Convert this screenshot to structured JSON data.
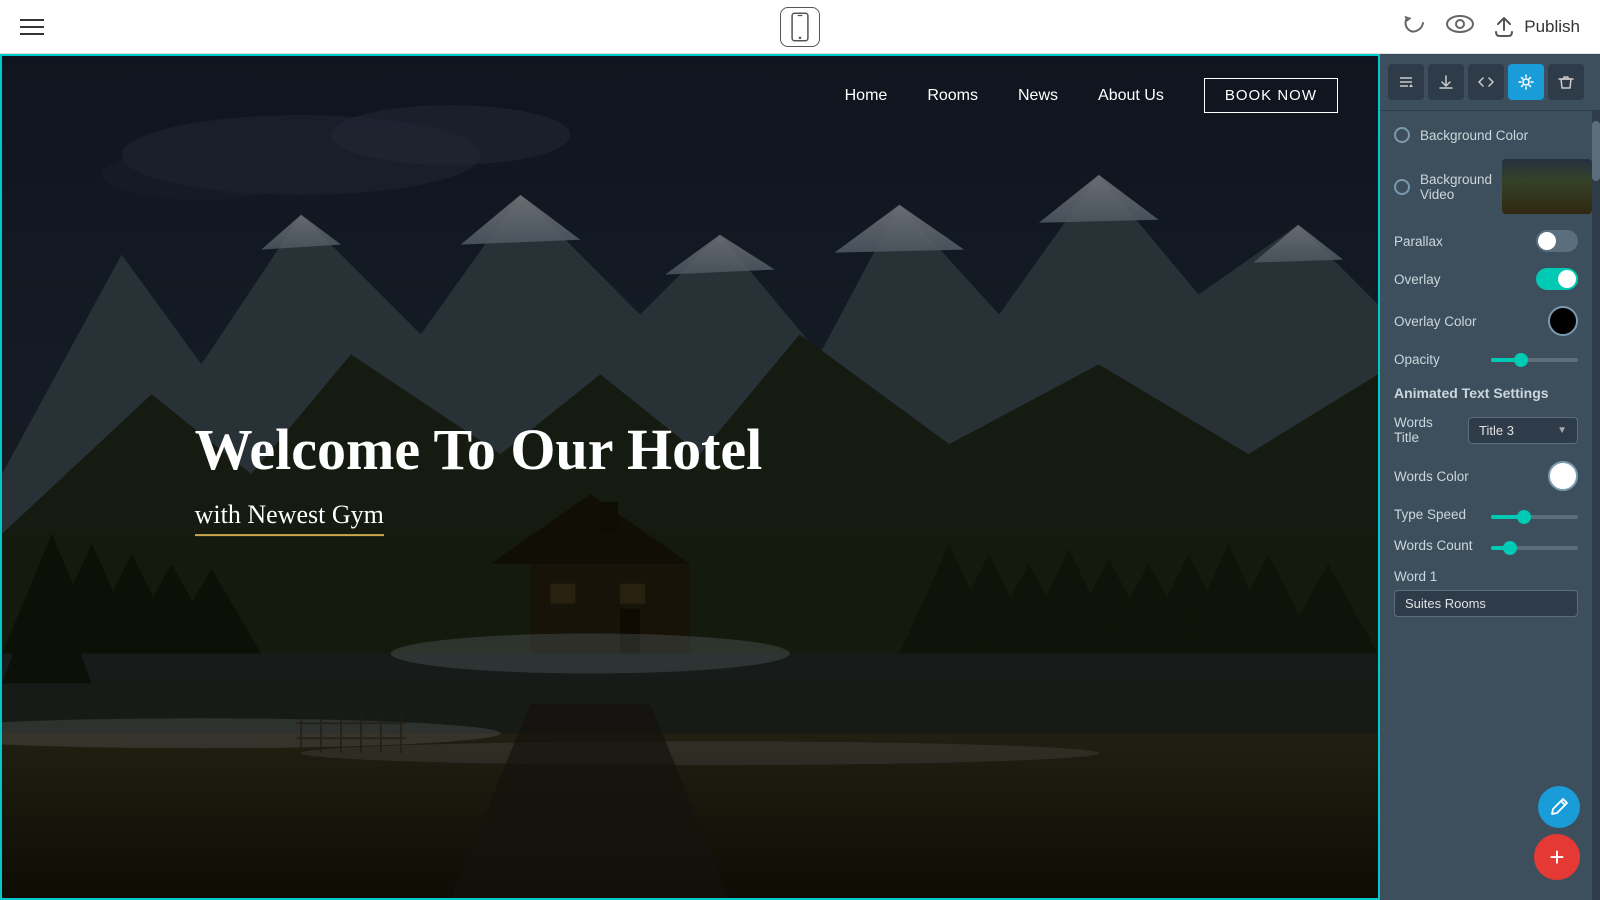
{
  "topbar": {
    "hamburger_label": "menu",
    "phone_icon": "phone-icon",
    "undo_icon": "undo-icon",
    "eye_icon": "eye-icon",
    "upload_icon": "upload-icon",
    "publish_label": "Publish"
  },
  "nav": {
    "items": [
      "Home",
      "Rooms",
      "News",
      "About Us"
    ],
    "book_button": "BOOK NOW"
  },
  "hero": {
    "title": "Welcome To Our Hotel",
    "subtitle": "with Newest Gym"
  },
  "panel": {
    "toolbar": {
      "reorder_icon": "reorder-icon",
      "download_icon": "download-icon",
      "code_icon": "code-icon",
      "settings_icon": "settings-icon",
      "delete_icon": "delete-icon"
    },
    "sections": {
      "background_color_label": "Background Color",
      "background_video_label": "Background Video",
      "parallax_label": "Parallax",
      "overlay_label": "Overlay",
      "overlay_color_label": "Overlay Color",
      "opacity_label": "Opacity",
      "animated_text_settings_label": "Animated Text Settings",
      "words_title_label": "Words Title",
      "words_title_value": "Title 3",
      "words_color_label": "Words Color",
      "type_speed_label": "Type Speed",
      "words_count_label": "Words Count",
      "word_1_label": "Word 1",
      "word_1_value": "Suites Rooms"
    },
    "parallax_on": false,
    "overlay_on": true,
    "overlay_color": "#000000",
    "words_color": "#ffffff",
    "opacity_pct": 35,
    "type_speed_pct": 38,
    "words_count_pct": 22
  },
  "fabs": {
    "edit_label": "✏",
    "add_label": "+"
  }
}
